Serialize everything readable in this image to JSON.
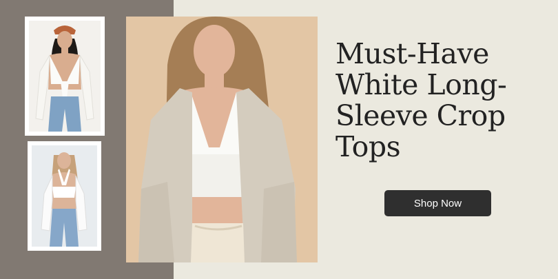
{
  "banner": {
    "headline_lines": [
      "Must-Have",
      "White Long-",
      "Sleeve Crop",
      "Tops"
    ],
    "cta_label": "Shop Now"
  },
  "colors": {
    "left_band": "#817972",
    "background": "#ebe9df",
    "headline_text": "#222222",
    "button_bg": "#2f2f2f",
    "button_text": "#ffffff"
  },
  "images": [
    {
      "name": "model-photo-tie-front-crop-top"
    },
    {
      "name": "model-photo-halter-crop-top"
    },
    {
      "name": "hero-model-photo-cardigan-crop-top"
    }
  ]
}
